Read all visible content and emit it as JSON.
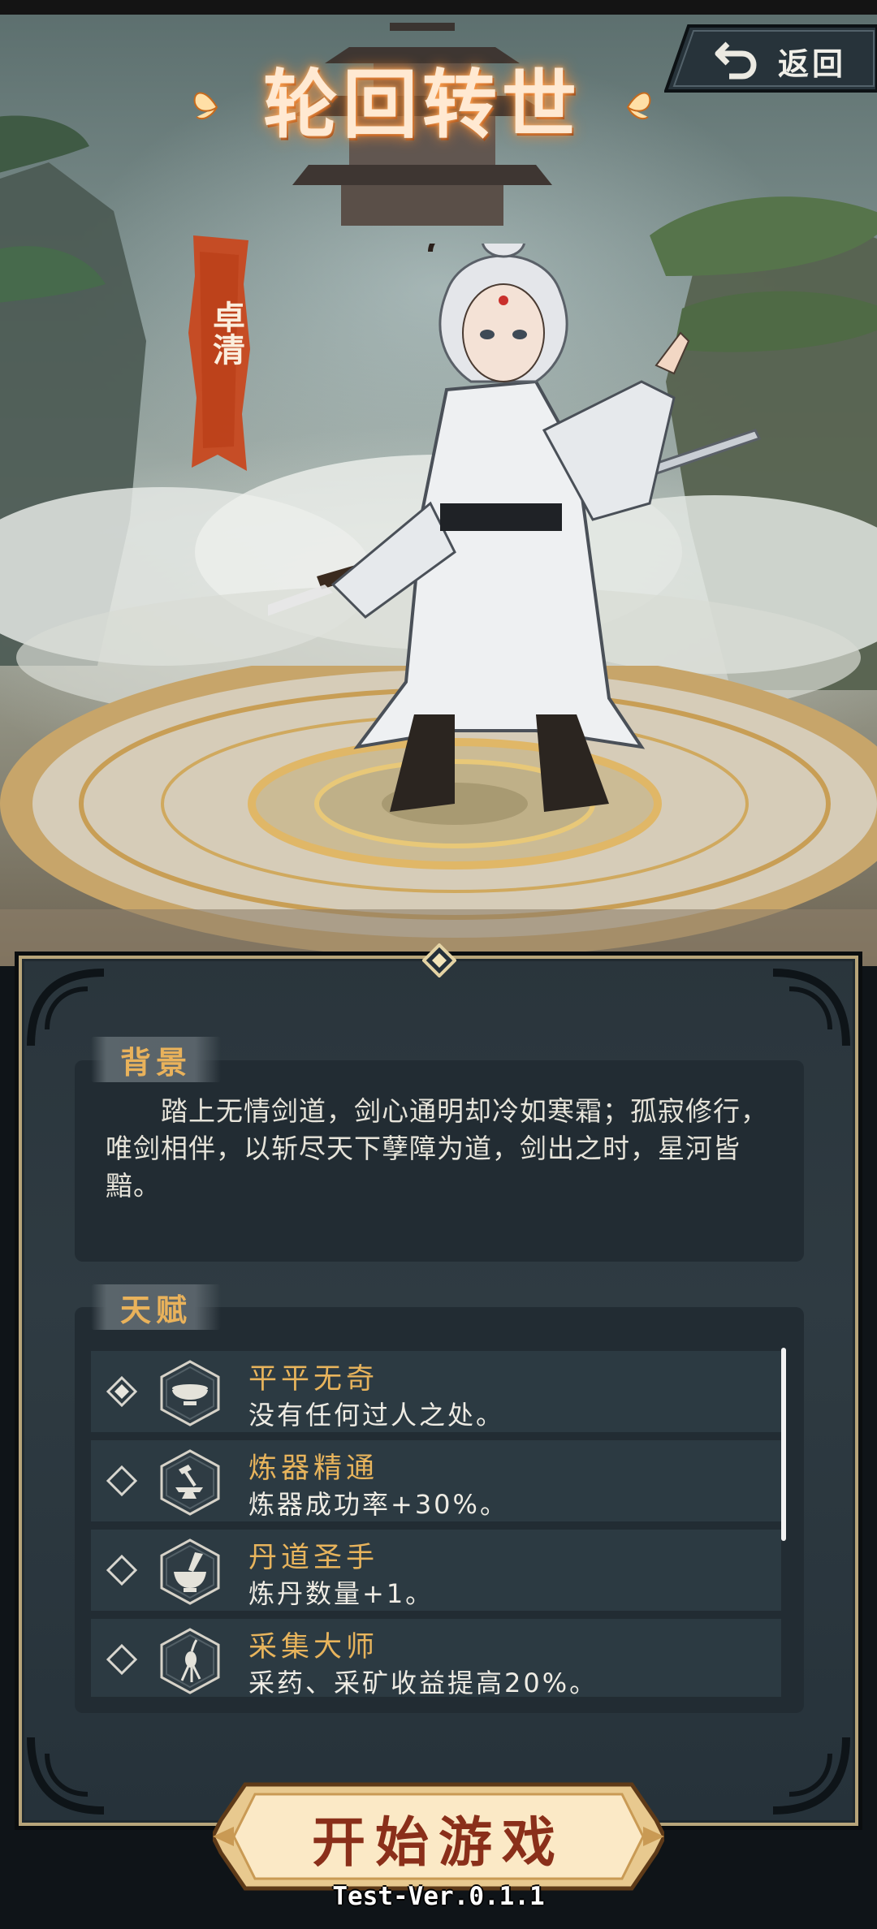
{
  "title": "轮回转世",
  "back_button": {
    "label": "返回",
    "icon": "return-arrow-icon"
  },
  "character": {
    "name": "卓清"
  },
  "background_section": {
    "tab_label": "背景",
    "text": "踏上无情剑道，剑心通明却冷如寒霜；孤寂修行，唯剑相伴，以斩尽天下孽障为道，剑出之时，星河皆黯。"
  },
  "talent_section": {
    "tab_label": "天赋",
    "items": [
      {
        "name": "平平无奇",
        "desc": "没有任何过人之处。",
        "icon": "bowl-icon",
        "selected": true
      },
      {
        "name": "炼器精通",
        "desc": "炼器成功率+30%。",
        "icon": "anvil-hammer-icon",
        "selected": false
      },
      {
        "name": "丹道圣手",
        "desc": "炼丹数量+1。",
        "icon": "mortar-pestle-icon",
        "selected": false
      },
      {
        "name": "采集大师",
        "desc": "采药、采矿收益提高20%。",
        "icon": "ginseng-root-icon",
        "selected": false
      }
    ]
  },
  "start_button": {
    "label": "开始游戏"
  },
  "version": "Test-Ver.0.1.1",
  "colors": {
    "accent_gold": "#e8b45c",
    "panel_bg": "#2f3b42",
    "banner_red": "#c8481f",
    "start_text": "#8a2f1a"
  }
}
